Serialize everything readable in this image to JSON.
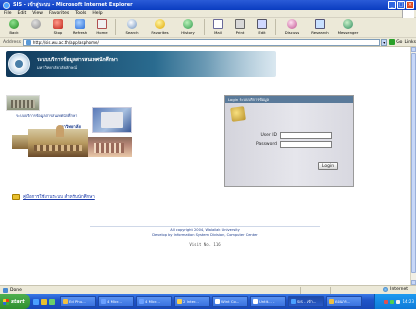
{
  "window": {
    "title": "SIS - เข้าสู่ระบบ - Microsoft Internet Explorer",
    "controls": [
      "_",
      "□",
      "×"
    ]
  },
  "menu": [
    "File",
    "Edit",
    "View",
    "Favorites",
    "Tools",
    "Help"
  ],
  "toolbar": {
    "buttons": [
      {
        "label": "Back",
        "icon": "back-arrow-icon"
      },
      {
        "label": "",
        "icon": "forward-arrow-icon"
      },
      {
        "label": "Stop",
        "icon": "stop-icon"
      },
      {
        "label": "Refresh",
        "icon": "refresh-icon"
      },
      {
        "label": "Home",
        "icon": "home-icon"
      },
      {
        "label": "Search",
        "icon": "search-icon"
      },
      {
        "label": "Favorites",
        "icon": "favorites-star-icon"
      },
      {
        "label": "History",
        "icon": "history-icon"
      },
      {
        "label": "Mail",
        "icon": "mail-icon"
      },
      {
        "label": "Print",
        "icon": "print-icon"
      },
      {
        "label": "Edit",
        "icon": "edit-icon"
      },
      {
        "label": "Discuss",
        "icon": "discuss-icon"
      },
      {
        "label": "Research",
        "icon": "research-icon"
      },
      {
        "label": "Messenger",
        "icon": "messenger-icon"
      }
    ]
  },
  "address": {
    "label": "Address",
    "url": "http://sis.wu.ac.th/app/asphome/",
    "go": "Go",
    "links": "Links"
  },
  "page": {
    "banner": {
      "line1": "ระบบบริการข้อมูลสารสนเทศนักศึกษา",
      "line2": "มหาวิทยาลัยวลัยลักษณ์"
    },
    "collage": {
      "caption1": "ระบบบริการข้อมูลสารสนเทศนักศึกษา",
      "caption2": "มหาวิทยาลัย"
    },
    "login": {
      "header": "Login ระบบบริการข้อมูล",
      "user_label": "User ID",
      "password_label": "Password",
      "user_value": "",
      "password_value": "",
      "button": "Login"
    },
    "left_link": "คู่มือการใช้งานระบบ สำหรับนักศึกษา",
    "footer": {
      "line1": "All copyright 2004, Walailak University",
      "line2": "Develop by Information System Division, Computer Center",
      "visitor": "Visit No. 116"
    }
  },
  "status": {
    "text": "Done",
    "zone": "Internet"
  },
  "taskbar": {
    "start": "start",
    "tasks": [
      {
        "label": "Ed Phu...",
        "color": "#f0c040",
        "active": false
      },
      {
        "label": "4 Micr...",
        "color": "#6aa0ff",
        "active": false
      },
      {
        "label": "4 Micr...",
        "color": "#6aa0ff",
        "active": false
      },
      {
        "label": "2 Inter...",
        "color": "#f8d050",
        "active": false
      },
      {
        "label": "Wint Co...",
        "color": "#ffffff",
        "active": false
      },
      {
        "label": "Untit... -",
        "color": "#ffffff",
        "active": false
      },
      {
        "label": "SIS - เข้า...",
        "color": "#4aa0ff",
        "active": true
      },
      {
        "label": "ดอนกร...",
        "color": "#f0c040",
        "active": false
      }
    ],
    "clock": "14:23",
    "colors": {
      "start": "#3a9a3a",
      "bar": "#245edb",
      "tray": "#0f8be0"
    }
  }
}
